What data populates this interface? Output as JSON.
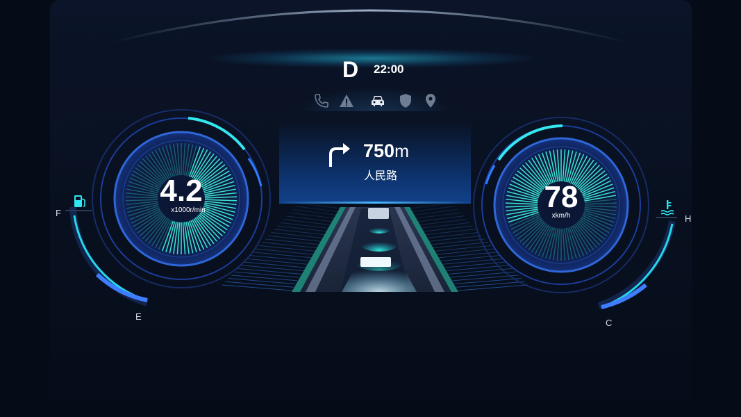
{
  "gear": "D",
  "time": "22:00",
  "status_icons": [
    "phone-icon",
    "warning-icon",
    "car-icon",
    "shield-icon",
    "location-pin-icon"
  ],
  "active_status_icon": "car-icon",
  "navigation": {
    "maneuver": "turn-right-icon",
    "distance_value": "750",
    "distance_unit": "m",
    "street": "人民路"
  },
  "tachometer": {
    "value": "4.2",
    "unit": "x1000r/min"
  },
  "speedometer": {
    "value": "78",
    "unit": "xkm/h"
  },
  "fuel_gauge": {
    "full_label": "F",
    "empty_label": "E",
    "icon": "fuel-pump-icon"
  },
  "temp_gauge": {
    "hot_label": "H",
    "cold_label": "C",
    "icon": "coolant-temp-icon"
  },
  "colors": {
    "accent": "#2ee6e6",
    "blue": "#1f6bff",
    "background": "#060b18"
  }
}
